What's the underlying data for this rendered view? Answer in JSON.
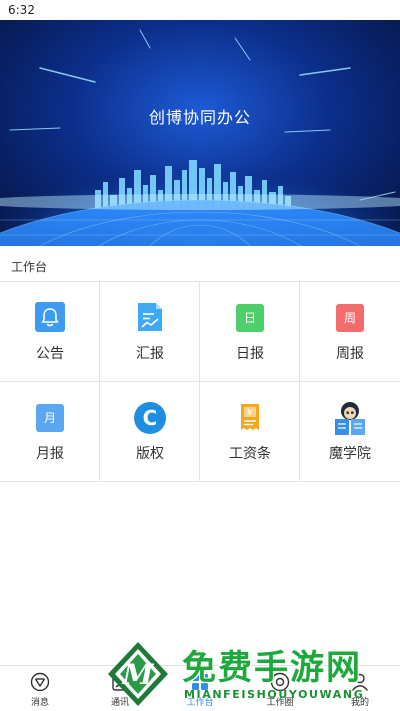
{
  "status_bar": {
    "time": "6:32"
  },
  "banner": {
    "title": "创博协同办公"
  },
  "section": {
    "title": "工作台"
  },
  "grid": {
    "items": [
      {
        "label": "公告",
        "icon": "bell-icon",
        "color": "#3d9cf0"
      },
      {
        "label": "汇报",
        "icon": "report-icon",
        "color": "#3fa9f5"
      },
      {
        "label": "日报",
        "icon": "daily-icon",
        "glyph": "日",
        "color": "#4fcf6a"
      },
      {
        "label": "周报",
        "icon": "weekly-icon",
        "glyph": "周",
        "color": "#f46b6b"
      },
      {
        "label": "月报",
        "icon": "monthly-icon",
        "glyph": "月",
        "color": "#5aa8f2"
      },
      {
        "label": "版权",
        "icon": "copyright-icon",
        "glyph": "C",
        "color": "#1e8fe0"
      },
      {
        "label": "工资条",
        "icon": "payslip-icon",
        "glyph": "¥",
        "color": "#f5a623"
      },
      {
        "label": "魔学院",
        "icon": "academy-icon",
        "color": "#3b8ee8"
      }
    ]
  },
  "bottom_nav": {
    "items": [
      {
        "label": "消息",
        "icon": "message-icon"
      },
      {
        "label": "通讯",
        "icon": "contacts-icon"
      },
      {
        "label": "工作台",
        "icon": "workbench-icon"
      },
      {
        "label": "工作圈",
        "icon": "circle-icon"
      },
      {
        "label": "我的",
        "icon": "profile-icon"
      }
    ]
  },
  "watermark": {
    "text": "免费手游网",
    "sub": "MIANFEISHOUYOUWANG"
  }
}
